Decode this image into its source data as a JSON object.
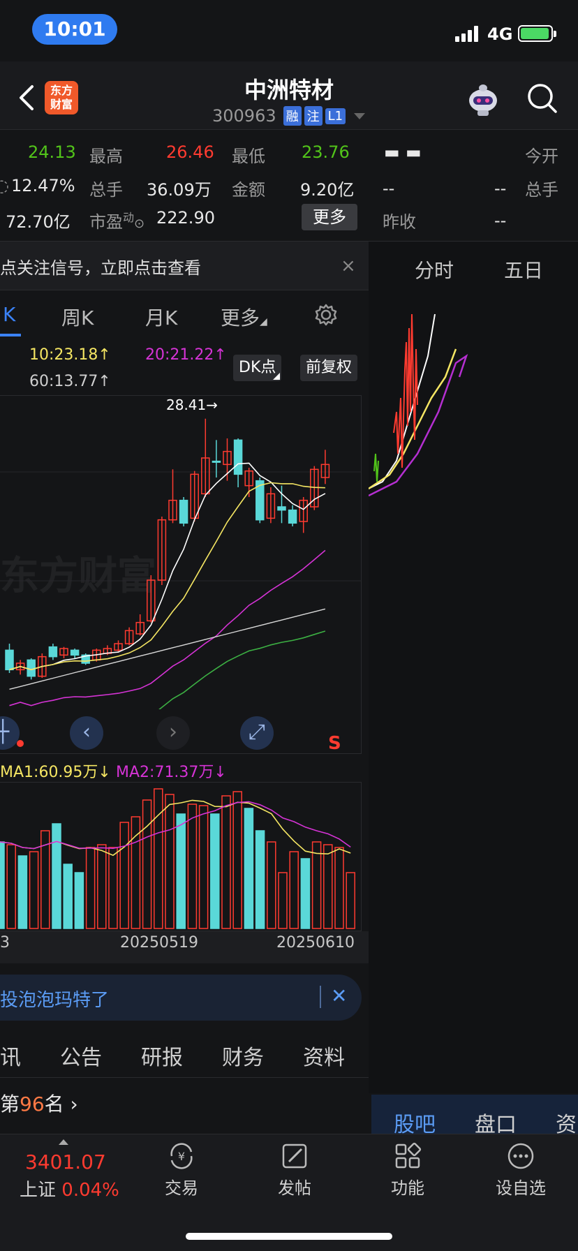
{
  "status": {
    "time": "10:01",
    "network": "4G"
  },
  "header": {
    "logo_line1": "东方",
    "logo_line2": "财富",
    "title": "中洲特材",
    "code": "300963",
    "tags": [
      "融",
      "注",
      "L1"
    ]
  },
  "quote": {
    "row1": {
      "v1": "24.13",
      "l2": "最高",
      "v2": "26.46",
      "l3": "最低",
      "v3": "23.76",
      "v4": "▬ ▬",
      "l5": "今开"
    },
    "row2": {
      "v1": "12.47%",
      "l2": "总手",
      "v2": "36.09万",
      "l3": "金额",
      "v3": "9.20亿",
      "v4": "--",
      "v5": "--",
      "l5": "总手"
    },
    "row3": {
      "v1": "72.70亿",
      "l2": "市盈",
      "l2sup": "动",
      "v2": "222.90",
      "more": "更多",
      "l4": "昨收",
      "v4": "--"
    }
  },
  "notice": {
    "text": "点关注信号，立即点击查看",
    "close": "×"
  },
  "right_tabs": [
    "分时",
    "五日"
  ],
  "ktabs": [
    "K",
    "周K",
    "月K",
    "更多"
  ],
  "ma": {
    "ma10": "10:23.18↑",
    "ma20": "20:21.22↑",
    "ma60": "60:13.77↑",
    "dk": "DK点",
    "fq": "前复权"
  },
  "chart": {
    "high_label": "28.41→",
    "watermark": "东方财富",
    "s_mark": "S",
    "nav": [
      "‹",
      "›"
    ]
  },
  "volume": {
    "ma1": "MA1:60.95万↓",
    "ma2": "MA2:71.37万↓",
    "dates": [
      "3",
      "20250519",
      "20250610"
    ]
  },
  "banner": {
    "text": "投泡泡玛特了",
    "close": "✕"
  },
  "info_tabs": [
    "讯",
    "公告",
    "研报",
    "财务",
    "资料"
  ],
  "rank": {
    "prefix": "第",
    "num": "96",
    "suffix": "名 ›"
  },
  "right_tabs2": [
    "股吧",
    "盘口",
    "资"
  ],
  "bottom": {
    "index_value": "3401.07",
    "index_name": "上证",
    "index_pct": "0.04%",
    "items": [
      "交易",
      "发帖",
      "功能",
      "设自选"
    ]
  },
  "colors": {
    "up": "#ff3b30",
    "down": "#5ad8d8",
    "ma5": "#ffffff",
    "ma10": "#f5e663",
    "ma20": "#d633d6",
    "ma60": "#3cb043"
  },
  "chart_data": {
    "type": "candlestick",
    "candles": [
      {
        "o": 14.2,
        "c": 13.0,
        "h": 14.6,
        "l": 12.8,
        "up": false
      },
      {
        "o": 13.0,
        "c": 13.4,
        "h": 13.6,
        "l": 12.7,
        "up": true
      },
      {
        "o": 13.6,
        "c": 12.6,
        "h": 13.7,
        "l": 12.4,
        "up": false
      },
      {
        "o": 12.6,
        "c": 13.8,
        "h": 14.0,
        "l": 12.5,
        "up": true
      },
      {
        "o": 14.4,
        "c": 13.8,
        "h": 14.6,
        "l": 13.6,
        "up": false
      },
      {
        "o": 13.9,
        "c": 14.3,
        "h": 14.4,
        "l": 13.7,
        "up": true
      },
      {
        "o": 14.2,
        "c": 13.9,
        "h": 14.3,
        "l": 13.7,
        "up": false
      },
      {
        "o": 13.9,
        "c": 13.4,
        "h": 14.0,
        "l": 13.3,
        "up": false
      },
      {
        "o": 13.6,
        "c": 14.2,
        "h": 14.3,
        "l": 13.5,
        "up": true
      },
      {
        "o": 14.0,
        "c": 14.3,
        "h": 14.5,
        "l": 13.9,
        "up": true
      },
      {
        "o": 14.2,
        "c": 14.6,
        "h": 14.8,
        "l": 14.1,
        "up": true
      },
      {
        "o": 14.6,
        "c": 15.4,
        "h": 15.6,
        "l": 14.5,
        "up": true
      },
      {
        "o": 15.2,
        "c": 15.9,
        "h": 16.4,
        "l": 15.1,
        "up": true
      },
      {
        "o": 16.0,
        "c": 18.5,
        "h": 18.8,
        "l": 15.9,
        "up": true
      },
      {
        "o": 18.5,
        "c": 22.2,
        "h": 22.4,
        "l": 18.2,
        "up": true
      },
      {
        "o": 22.2,
        "c": 23.4,
        "h": 25.3,
        "l": 22.0,
        "up": true
      },
      {
        "o": 23.4,
        "c": 22.0,
        "h": 23.6,
        "l": 21.8,
        "up": false
      },
      {
        "o": 22.3,
        "c": 25.0,
        "h": 25.2,
        "l": 22.1,
        "up": true
      },
      {
        "o": 23.8,
        "c": 26.0,
        "h": 28.41,
        "l": 23.6,
        "up": true
      },
      {
        "o": 25.8,
        "c": 25.8,
        "h": 27.1,
        "l": 24.8,
        "up": false
      },
      {
        "o": 25.6,
        "c": 26.4,
        "h": 27.2,
        "l": 24.6,
        "up": true
      },
      {
        "o": 27.1,
        "c": 25.0,
        "h": 27.2,
        "l": 24.2,
        "up": false
      },
      {
        "o": 24.3,
        "c": 25.2,
        "h": 25.4,
        "l": 23.6,
        "up": true
      },
      {
        "o": 24.6,
        "c": 22.2,
        "h": 24.8,
        "l": 22.0,
        "up": false
      },
      {
        "o": 22.3,
        "c": 23.8,
        "h": 24.2,
        "l": 22.0,
        "up": true
      },
      {
        "o": 23.0,
        "c": 22.8,
        "h": 24.3,
        "l": 22.0,
        "up": false
      },
      {
        "o": 22.8,
        "c": 22.0,
        "h": 23.1,
        "l": 21.8,
        "up": false
      },
      {
        "o": 22.1,
        "c": 23.4,
        "h": 23.6,
        "l": 21.4,
        "up": true
      },
      {
        "o": 23.0,
        "c": 25.3,
        "h": 25.5,
        "l": 22.8,
        "up": true
      },
      {
        "o": 24.8,
        "c": 25.6,
        "h": 26.5,
        "l": 24.4,
        "up": true
      }
    ],
    "ylim": [
      11,
      29
    ],
    "volumes": [
      62,
      60,
      52,
      55,
      70,
      75,
      46,
      40,
      58,
      60,
      58,
      76,
      80,
      92,
      100,
      96,
      82,
      89,
      88,
      82,
      95,
      98,
      86,
      70,
      62,
      40,
      55,
      50,
      62,
      60,
      58,
      40
    ],
    "vol_up": [
      false,
      true,
      false,
      true,
      true,
      false,
      false,
      false,
      true,
      true,
      true,
      true,
      true,
      true,
      true,
      true,
      false,
      true,
      true,
      false,
      true,
      true,
      false,
      false,
      true,
      true,
      true,
      false,
      true,
      true,
      true,
      true
    ]
  }
}
